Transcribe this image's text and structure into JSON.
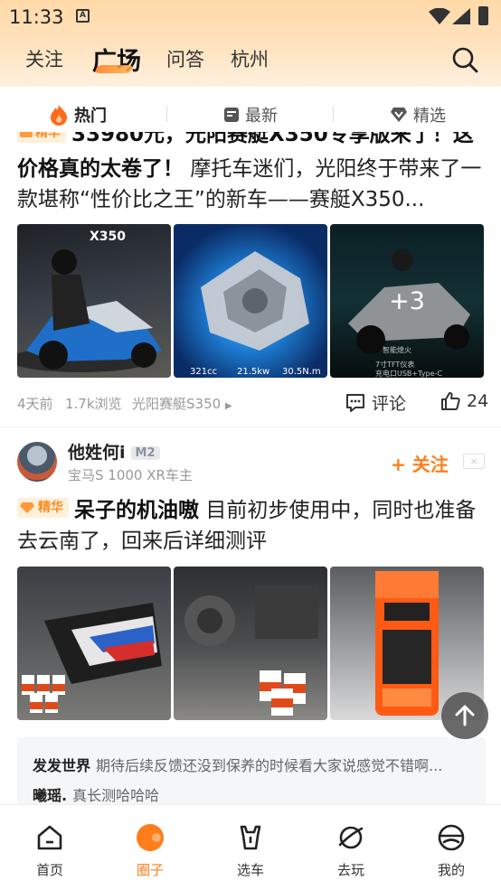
{
  "status": {
    "time": "11:33",
    "a_icon": "A"
  },
  "top_tabs": [
    "关注",
    "广场",
    "问答",
    "杭州"
  ],
  "sub_tabs": [
    {
      "label": "热门",
      "icon": "fire-icon",
      "active": true
    },
    {
      "label": "最新",
      "icon": "note-icon"
    },
    {
      "label": "精选",
      "icon": "heart-diamond-icon"
    }
  ],
  "post1": {
    "cut_title": "33980元，光阳赛艇X350专享版来了！这",
    "title_bold": "价格真的太卷了！",
    "body": "摩托车迷们，光阳终于带来了一款堪称“性价比之王”的新车——赛艇X350...",
    "more_count": "+3",
    "image_caption_left": "321cc",
    "image_caption_mid": "21.5kw",
    "image_caption_right": "30.5N.m",
    "image_note1": "7寸TFT仪表",
    "image_note2": "充电口USB+Type-C",
    "image_note3": "智能熄火",
    "time": "4天前",
    "views": "1.7k浏览",
    "topic": "光阳赛艇S350",
    "comment_label": "评论",
    "like_count": "24"
  },
  "post2": {
    "user_name": "他姓何i",
    "user_level": "M2",
    "user_sub": "宝马S 1000 XR车主",
    "follow_label": "+ 关注",
    "tag": "精华",
    "title_bold": "呆子的机油嗷",
    "body": "目前初步使用中，同时也准备去云南了，回来后详细测评",
    "comments": [
      {
        "user": "发发世界",
        "text": "期待后续反馈还没到保养的时候看大家说感觉不错啊..."
      },
      {
        "user": "曦瑶.",
        "text": "真长测哈哈哈"
      }
    ]
  },
  "nav": [
    {
      "label": "首页",
      "icon": "home-icon"
    },
    {
      "label": "圈子",
      "icon": "circle-icon",
      "active": true
    },
    {
      "label": "选车",
      "icon": "car-select-icon"
    },
    {
      "label": "去玩",
      "icon": "planet-icon"
    },
    {
      "label": "我的",
      "icon": "profile-icon"
    }
  ],
  "colors": {
    "accent": "#ff7d1a",
    "header_bg": "#ffe3bf"
  }
}
